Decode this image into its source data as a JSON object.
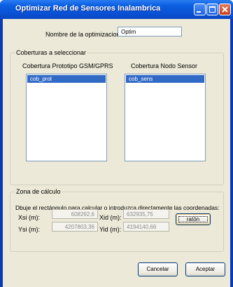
{
  "window": {
    "title": "Optimizar Red de Sensores Inalambrica"
  },
  "form": {
    "optimization_name_label": "Nombre de la optimizacion:",
    "optimization_name_value": "Optim"
  },
  "coverage_group": {
    "title": "Coberturas a seleccionar",
    "left_list": {
      "header": "Cobertura Prototipo GSM/GPRS",
      "items": [
        "cob_prot"
      ]
    },
    "right_list": {
      "header": "Cobertura Nodo Sensor",
      "items": [
        "cob_sens"
      ]
    }
  },
  "calc_zone": {
    "title": "Zona de cálculo",
    "instructions": "Dbuje el rectángulo para calcular o introduzca directamente las coordenadas:",
    "xsi_label": "Xsi (m):",
    "xsi_value": "608292,6",
    "ysi_label": "Ysi (m):",
    "ysi_value": "4207803,36",
    "xid_label": "Xid (m):",
    "xid_value": "632935,75",
    "yid_label": "Yid (m):",
    "yid_value": "4194140,66",
    "mouse_button": "ratón"
  },
  "buttons": {
    "cancel": "Cancelar",
    "accept": "Aceptar"
  }
}
